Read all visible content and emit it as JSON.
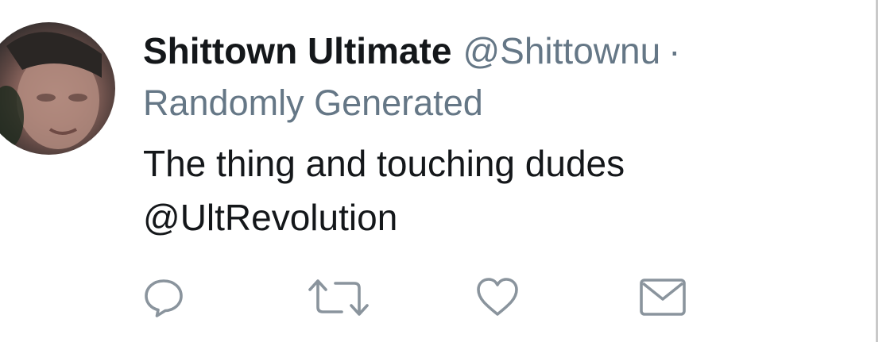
{
  "tweet": {
    "display_name": "Shittown Ultimate",
    "handle": "@Shittownu",
    "separator": "·",
    "subtitle": "Randomly Generated",
    "text_line_1": "The thing and touching dudes",
    "text_line_2": "@UltRevolution"
  },
  "actions": [
    {
      "name": "reply",
      "icon": "reply-icon"
    },
    {
      "name": "retweet",
      "icon": "retweet-icon"
    },
    {
      "name": "like",
      "icon": "heart-icon"
    },
    {
      "name": "message",
      "icon": "mail-icon"
    }
  ],
  "colors": {
    "text_primary": "#14171a",
    "text_secondary": "#657786",
    "icon_gray": "#8a949d",
    "divider": "#c9c9c9"
  }
}
